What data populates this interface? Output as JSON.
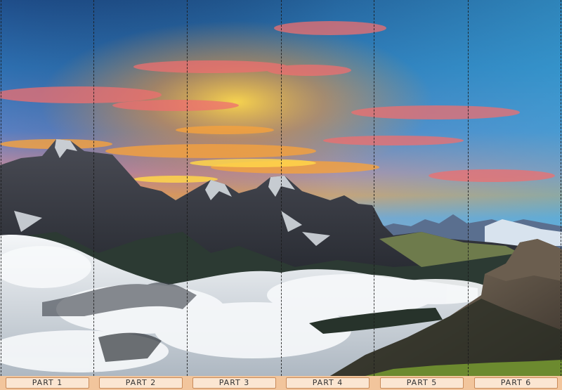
{
  "panels": [
    {
      "label": "PART 1"
    },
    {
      "label": "PART 2"
    },
    {
      "label": "PART 3"
    },
    {
      "label": "PART 4"
    },
    {
      "label": "PART 5"
    },
    {
      "label": "PART 6"
    }
  ],
  "colors": {
    "sky_top": "#1f4e8a",
    "sky_mid": "#3a8fd0",
    "sunset_pink": "#ef6a6a",
    "sunset_orange": "#f6a23d",
    "horizon_yellow": "#ffd54a",
    "mountain_dark": "#2b2f36",
    "cloud_white": "#e9eef2",
    "grass": "#6c8a2f",
    "label_bar": "#f2c59c",
    "label_fill": "#fbe6d2",
    "label_border": "#c88b5b"
  }
}
